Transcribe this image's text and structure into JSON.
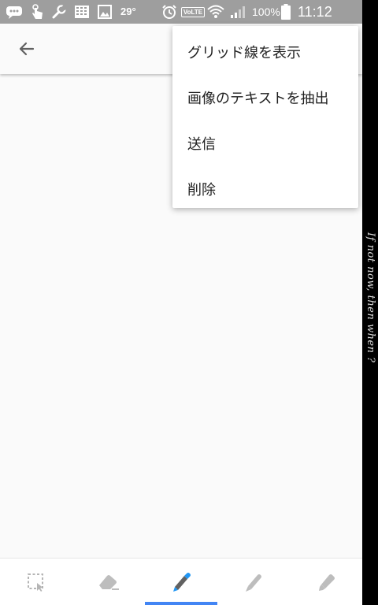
{
  "status_bar": {
    "temperature": "29°",
    "battery_percent": "100%",
    "time": "11:12",
    "volte_label": "VoLTE",
    "icons": [
      "chat-bubble-icon",
      "touch-icon",
      "wrench-icon",
      "keyboard-icon",
      "image-icon",
      "alarm-icon",
      "volte-icon",
      "wifi-icon",
      "signal-icon",
      "battery-icon"
    ]
  },
  "app_bar": {
    "back_icon": "arrow-back-icon"
  },
  "menu": {
    "items": [
      {
        "label": "グリッド線を表示"
      },
      {
        "label": "画像のテキストを抽出"
      },
      {
        "label": "送信"
      },
      {
        "label": "削除"
      }
    ]
  },
  "toolbar": {
    "tools": [
      {
        "name": "lasso-select-tool",
        "icon": "lasso-select-icon"
      },
      {
        "name": "eraser-tool",
        "icon": "eraser-icon"
      },
      {
        "name": "pen-tool",
        "icon": "pen-icon",
        "selected": true
      },
      {
        "name": "pencil-tool",
        "icon": "pencil-icon"
      },
      {
        "name": "highlighter-tool",
        "icon": "highlighter-icon"
      }
    ],
    "selected_color": "#4285f4"
  },
  "edge_text": "If not now, then when ?",
  "colors": {
    "status_bar_bg": "#9e9e9e",
    "background": "#fafafa",
    "accent": "#4285f4",
    "pen_blue": "#2196f3"
  }
}
